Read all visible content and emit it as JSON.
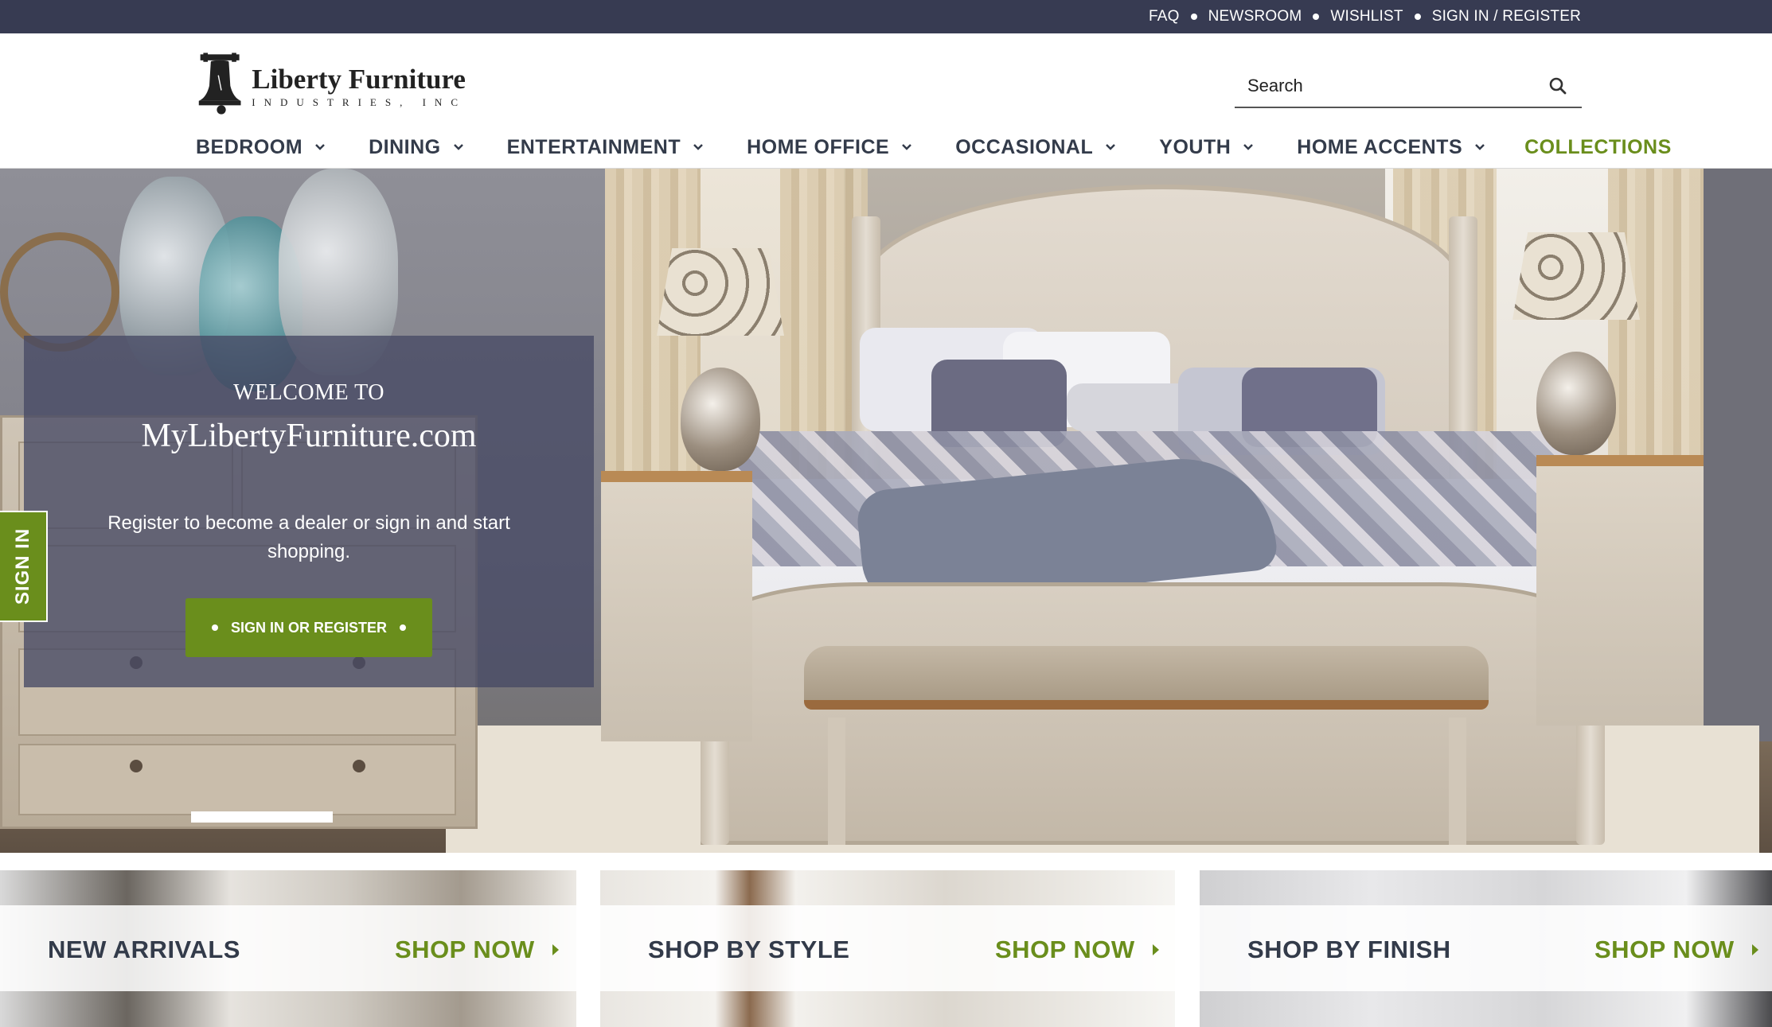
{
  "topbar": {
    "links": [
      "FAQ",
      "NEWSROOM",
      "WISHLIST",
      "SIGN IN / REGISTER"
    ]
  },
  "header": {
    "logo_main": "Liberty Furniture",
    "logo_sub": "INDUSTRIES, INC",
    "search_placeholder": "Search"
  },
  "nav": {
    "items": [
      {
        "label": "BEDROOM"
      },
      {
        "label": "DINING"
      },
      {
        "label": "ENTERTAINMENT"
      },
      {
        "label": "HOME OFFICE"
      },
      {
        "label": "OCCASIONAL"
      },
      {
        "label": "YOUTH"
      },
      {
        "label": "HOME ACCENTS"
      }
    ],
    "collections": "COLLECTIONS"
  },
  "hero": {
    "welcome_small": "WELCOME TO",
    "welcome_big": "MyLibertyFurniture.com",
    "welcome_text": "Register to become a dealer or sign in and start shopping.",
    "button_label": "SIGN IN OR REGISTER",
    "side_tab": "SIGN IN"
  },
  "promos": [
    {
      "title": "NEW ARRIVALS",
      "cta": "SHOP NOW"
    },
    {
      "title": "SHOP BY STYLE",
      "cta": "SHOP NOW"
    },
    {
      "title": "SHOP BY FINISH",
      "cta": "SHOP NOW"
    }
  ],
  "colors": {
    "topbar": "#373b52",
    "accent_green": "#6a8e1c",
    "nav_text": "#333b4a"
  }
}
